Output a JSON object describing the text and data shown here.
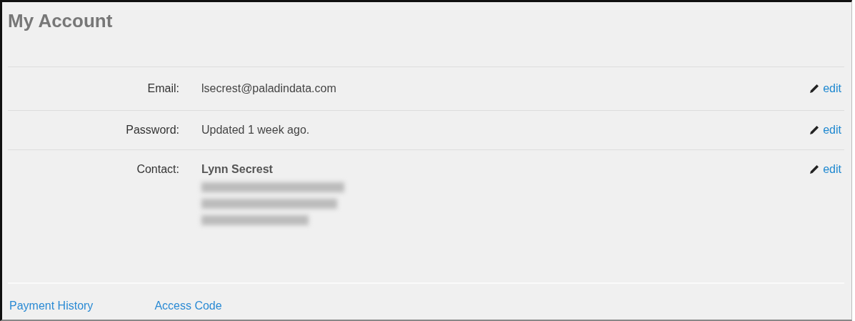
{
  "title": "My Account",
  "fields": [
    {
      "label": "Email:",
      "value": "lsecrest@paladindata.com",
      "action": "edit"
    },
    {
      "label": "Password:",
      "value": "Updated 1 week ago.",
      "action": "edit"
    },
    {
      "label": "Contact:",
      "value": "Lynn Secrest",
      "action": "edit",
      "details": [
        {
          "kind": "redacted"
        },
        {
          "kind": "redacted"
        },
        {
          "kind": "redacted"
        }
      ]
    }
  ],
  "links": [
    "Payment History",
    "Access Code"
  ]
}
